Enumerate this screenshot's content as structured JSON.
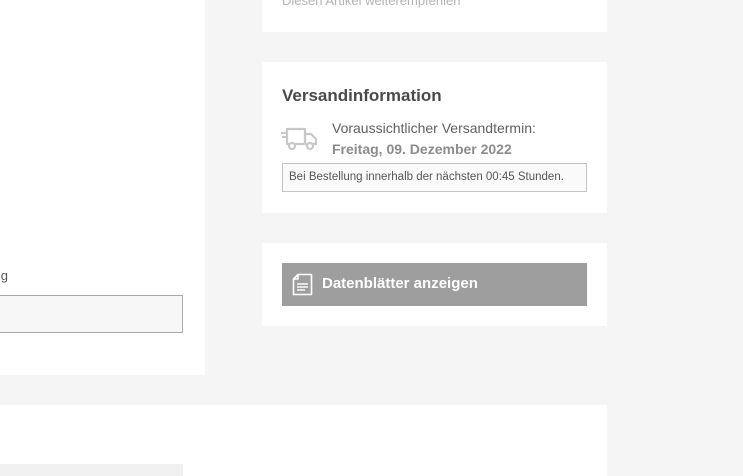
{
  "share": {
    "label": "Diesen Artikel weiterempfehlen"
  },
  "form": {
    "label_fragment": "g"
  },
  "shipping": {
    "title": "Versandinformation",
    "icon": "truck-icon",
    "estimated_label": "Voraussichtlicher Versandtermin:",
    "date": "Freitag, 09. Dezember 2022",
    "note": "Bei Bestellung innerhalb der nächsten 00:45 Stunden."
  },
  "datasheet": {
    "icon": "document-icon",
    "button_label": "Datenblätter anzeigen"
  },
  "colors": {
    "page_background": "#f5f5f5",
    "panel_background": "#ffffff",
    "button_background": "#9e9e9e",
    "button_text": "#ffffff"
  }
}
